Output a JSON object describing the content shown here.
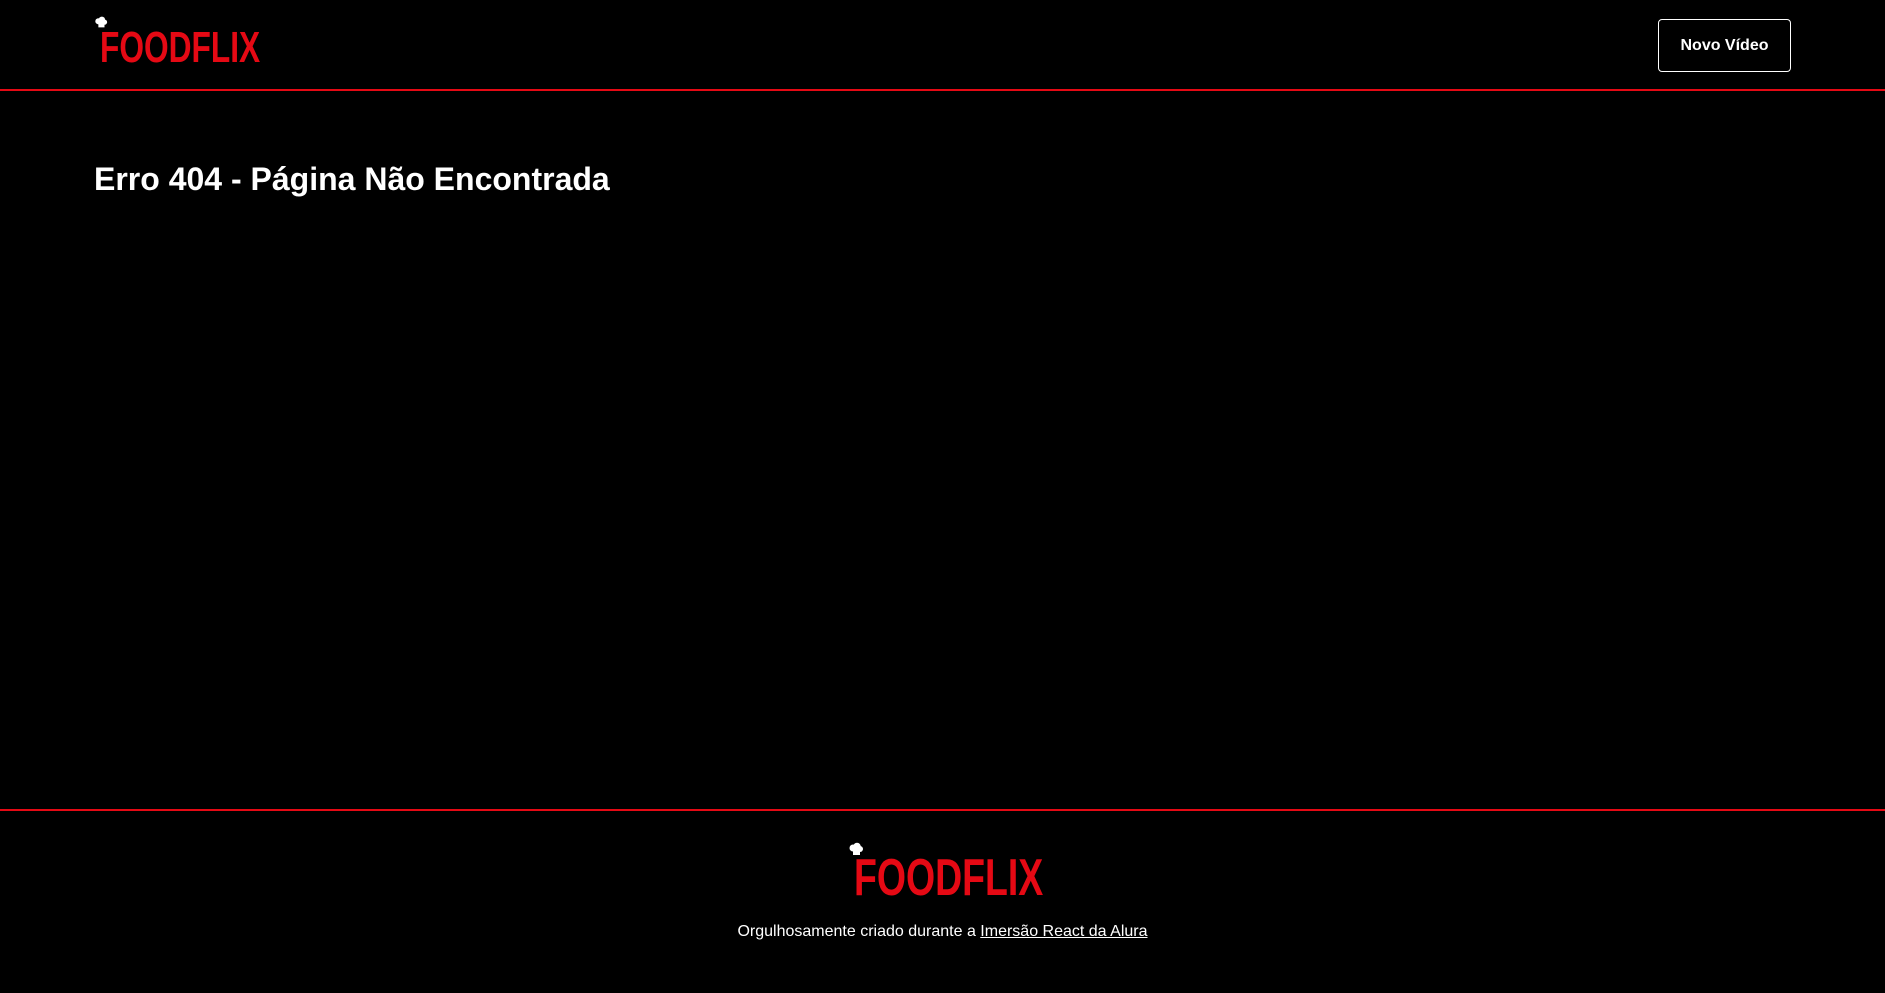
{
  "brand": {
    "name": "FOODFLIX",
    "accent_color": "#e50914",
    "logo_icon": "chef-hat-icon"
  },
  "header": {
    "new_video_label": "Novo Vídeo"
  },
  "main": {
    "title": "Erro 404 - Página Não Encontrada"
  },
  "footer": {
    "credit_text": "Orgulhosamente criado durante a ",
    "link_text": "Imersão React da Alura"
  }
}
